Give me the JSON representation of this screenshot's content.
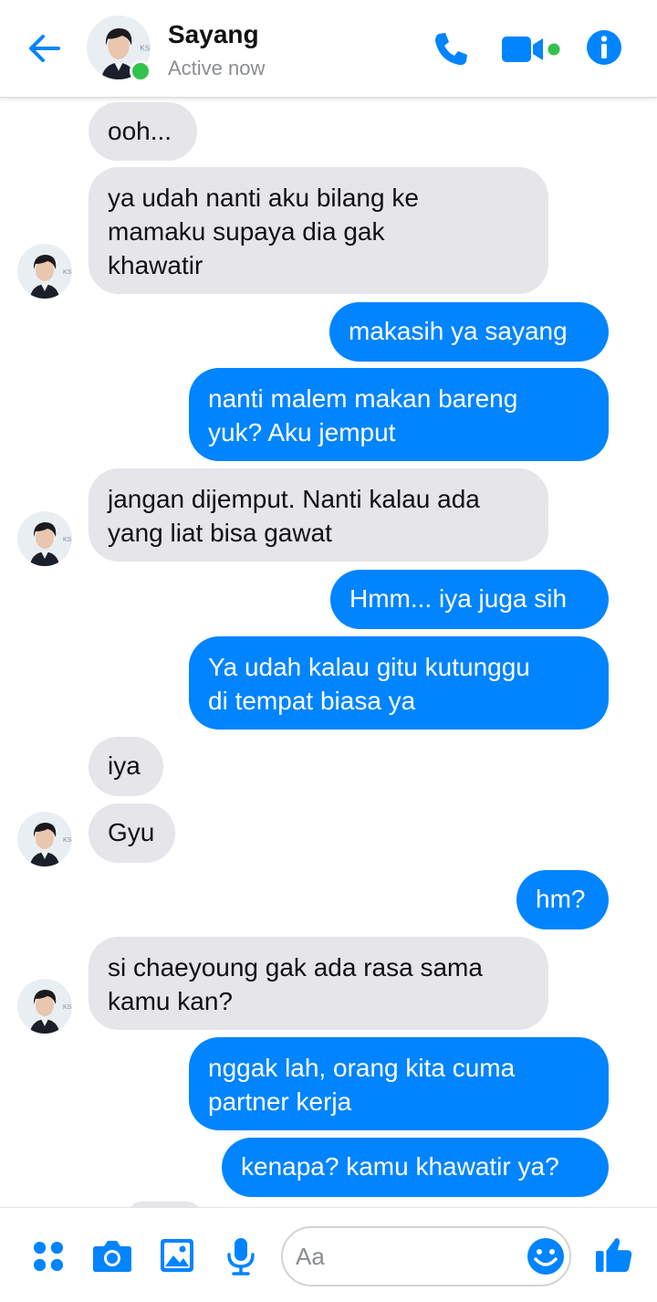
{
  "header": {
    "contact_name": "Sayang",
    "status": "Active now",
    "accent": "#0084ff",
    "online_color": "#32c24d"
  },
  "messages": [
    {
      "side": "in",
      "text": "ooh..."
    },
    {
      "side": "in",
      "text": "ya udah nanti aku bilang ke\nmamaku supaya dia gak\nkhawatir"
    },
    {
      "side": "out",
      "text": "makasih ya sayang"
    },
    {
      "side": "out",
      "text": "nanti malem makan bareng\nyuk? Aku jemput"
    },
    {
      "side": "in",
      "text": "jangan dijemput. Nanti kalau ada\nyang liat bisa gawat"
    },
    {
      "side": "out",
      "text": "Hmm... iya juga sih"
    },
    {
      "side": "out",
      "text": "Ya udah kalau gitu kutunggu\ndi tempat biasa ya"
    },
    {
      "side": "in",
      "text": "iya"
    },
    {
      "side": "in",
      "text": "Gyu"
    },
    {
      "side": "out",
      "text": "hm?"
    },
    {
      "side": "in",
      "text": "si chaeyoung gak ada rasa sama\nkamu kan?"
    },
    {
      "side": "out",
      "text": "nggak lah, orang kita cuma\npartner kerja"
    },
    {
      "side": "out",
      "text": "kenapa? kamu khawatir ya?"
    }
  ],
  "composer": {
    "placeholder": "Aa",
    "icons": [
      "apps-icon",
      "camera-icon",
      "gallery-icon",
      "microphone-icon",
      "emoji-icon",
      "thumbs-up-icon"
    ]
  },
  "colors": {
    "incoming_bubble": "#e5e5ea",
    "outgoing_bubble": "#0084ff"
  }
}
